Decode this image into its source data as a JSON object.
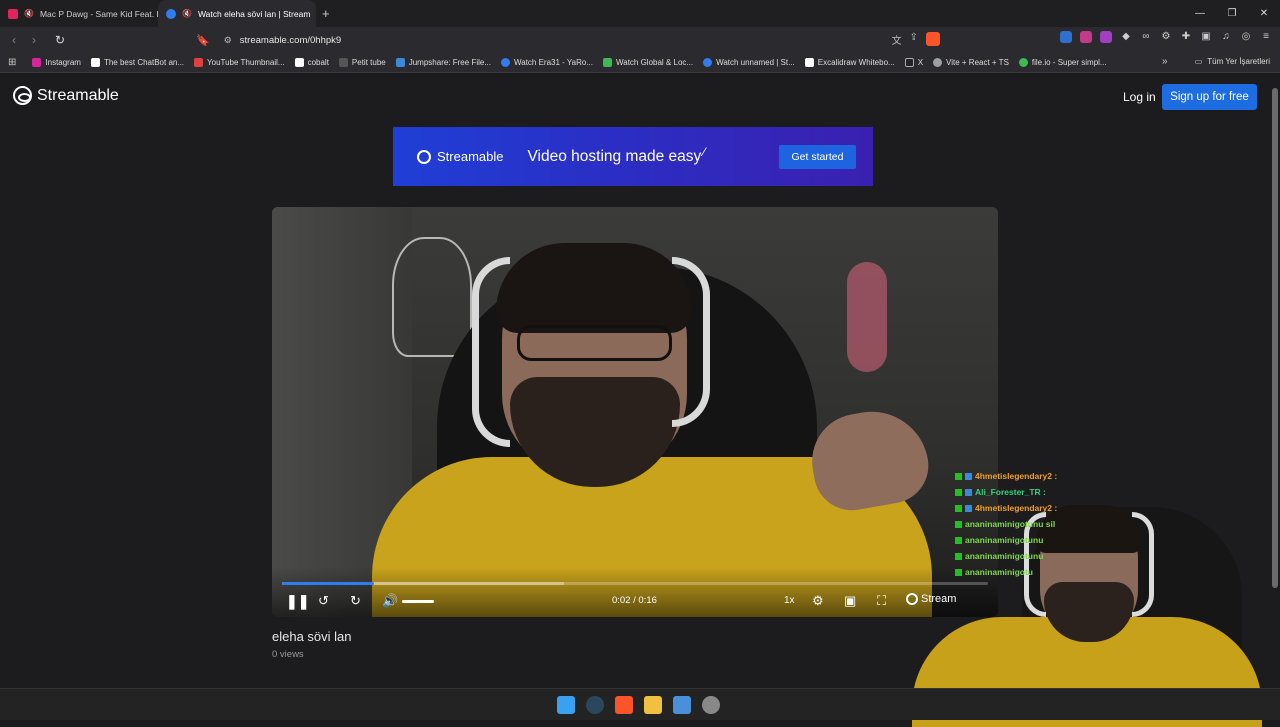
{
  "browser": {
    "tabs": [
      {
        "title": "Mac P Dawg - Same Kid Feat. Bo",
        "icon_color": "#e0245e",
        "muted": true,
        "active": false
      },
      {
        "title": "Watch eleha sövi lan | Stream",
        "icon_color": "#2f7df0",
        "muted": true,
        "active": true
      }
    ],
    "new_tab": "+",
    "address": "streamable.com/0hhpk9",
    "bookmarks": [
      {
        "label": "Instagram",
        "color": "#d6249f"
      },
      {
        "label": "The best ChatBot an...",
        "color": "#ffffff"
      },
      {
        "label": "YouTube Thumbnail...",
        "color": "#e04040"
      },
      {
        "label": "cobalt",
        "color": "#ffffff"
      },
      {
        "label": "Petit tube",
        "color": "#555555"
      },
      {
        "label": "Jumpshare: Free File...",
        "color": "#3a8ad8"
      },
      {
        "label": "Watch Era31 - YaRo...",
        "color": "#2f7df0"
      },
      {
        "label": "Watch Global & Loc...",
        "color": "#3cba54"
      },
      {
        "label": "Watch unnamed | St...",
        "color": "#2f7df0"
      },
      {
        "label": "Excalidraw Whitebo...",
        "color": "#ffffff"
      },
      {
        "label": "X",
        "color": "#222222"
      },
      {
        "label": "Vite + React + TS",
        "color": "#9aa0a6"
      },
      {
        "label": "file.io - Super simpl...",
        "color": "#3cba54"
      }
    ],
    "all_bookmarks": "Tüm Yer İşaretleri"
  },
  "site": {
    "logo": "Streamable",
    "login": "Log in",
    "signup": "Sign up for free",
    "banner": {
      "brand": "Streamable",
      "tagline": "Video hosting made easy",
      "cta": "Get started"
    },
    "player": {
      "time": "0:02 / 0:16",
      "speed": "1x",
      "brand": "Stream",
      "progress_played": 0.13,
      "progress_buffered": 0.4
    },
    "video_title": "eleha sövi lan",
    "views": "0 views"
  },
  "overlay": {
    "chat": [
      {
        "user": "4hmetislegendary2 :",
        "color": "#f0a020"
      },
      {
        "user": "Ali_Forester_TR :",
        "color": "#33d17a"
      },
      {
        "user": "4hmetislegendary2 :",
        "color": "#f0a020"
      },
      {
        "user": "ananinaminigotunu sil",
        "color": "#7fd94a"
      },
      {
        "user": "ananinaminigotunu",
        "color": "#7fd94a"
      },
      {
        "user": "ananinaminigotunu",
        "color": "#7fd94a"
      },
      {
        "user": "ananinaminigotu",
        "color": "#7fd94a"
      }
    ]
  },
  "taskbar": {
    "icons": [
      {
        "name": "windows-start-icon",
        "color": "#3aa0f0"
      },
      {
        "name": "steam-icon",
        "color": "#2a475e"
      },
      {
        "name": "brave-icon",
        "color": "#fb542b"
      },
      {
        "name": "file-explorer-icon",
        "color": "#f0c040"
      },
      {
        "name": "app-icon",
        "color": "#4a90d9"
      },
      {
        "name": "discord-like-icon",
        "color": "#888888"
      }
    ]
  }
}
